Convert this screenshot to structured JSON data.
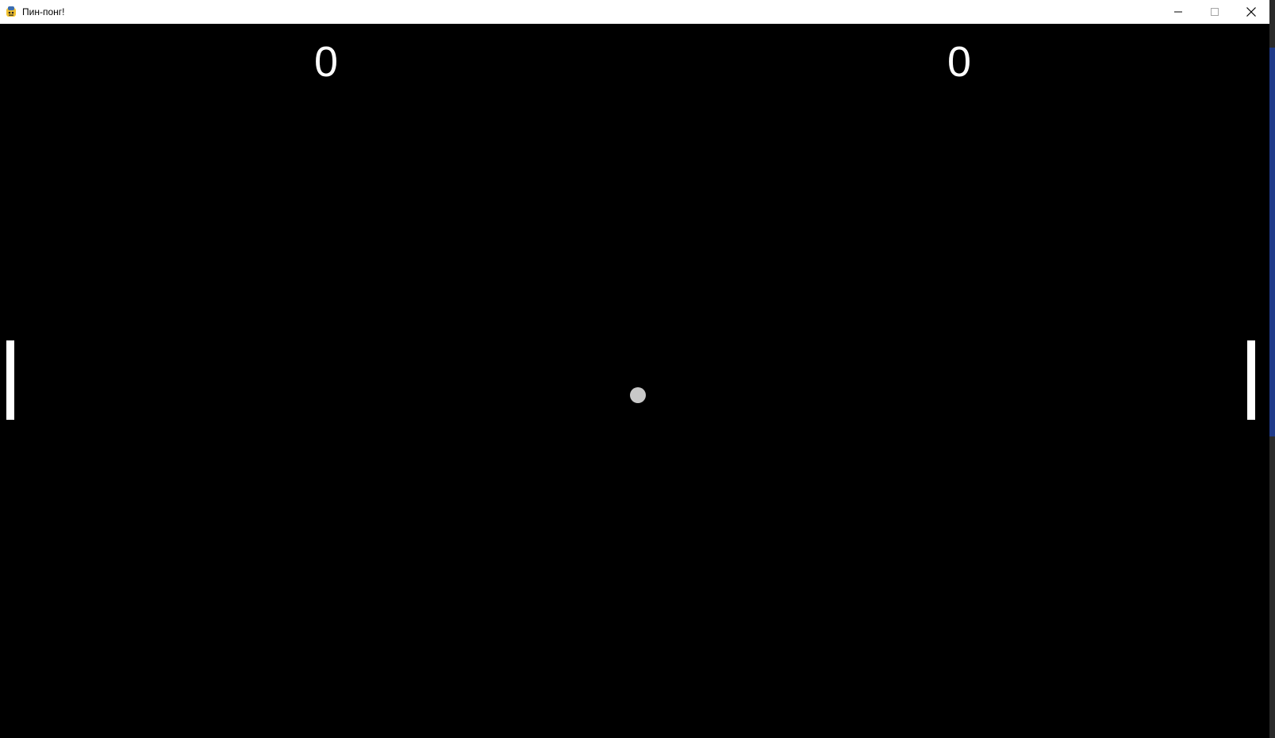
{
  "window": {
    "title": "Пин-понг!",
    "controls": {
      "minimize": "minimize-icon",
      "maximize": "maximize-icon",
      "close": "close-icon"
    }
  },
  "game": {
    "score_left": "0",
    "score_right": "0",
    "background": "#000000",
    "paddle_color": "#ffffff",
    "ball_color": "#c8c8c8"
  }
}
